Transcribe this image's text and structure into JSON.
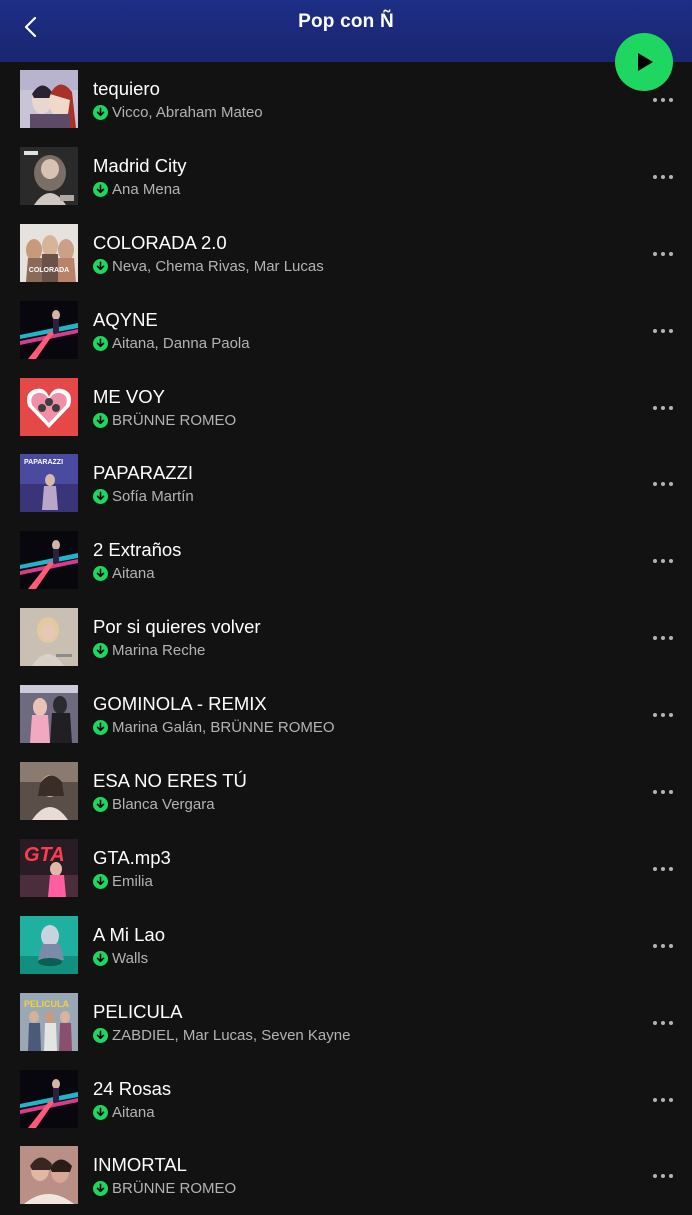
{
  "header": {
    "title": "Pop con Ñ",
    "background": "#1d2e86"
  },
  "play_button": {
    "color": "#1ed760",
    "icon": "play-icon"
  },
  "accent": "#1ed760",
  "tracks": [
    {
      "title": "tequiero",
      "artists": "Vicco, Abraham Mateo",
      "downloaded": true
    },
    {
      "title": "Madrid City",
      "artists": "Ana Mena",
      "downloaded": true
    },
    {
      "title": "COLORADA 2.0",
      "artists": "Neva, Chema Rivas, Mar Lucas",
      "downloaded": true
    },
    {
      "title": "AQYNE",
      "artists": "Aitana, Danna Paola",
      "downloaded": true
    },
    {
      "title": "ME VOY",
      "artists": "BRÜNNE ROMEO",
      "downloaded": true
    },
    {
      "title": "PAPARAZZI",
      "artists": "Sofía Martín",
      "downloaded": true
    },
    {
      "title": "2 Extraños",
      "artists": "Aitana",
      "downloaded": true
    },
    {
      "title": "Por si quieres volver",
      "artists": "Marina Reche",
      "downloaded": true
    },
    {
      "title": "GOMINOLA - REMIX",
      "artists": "Marina Galán, BRÜNNE ROMEO",
      "downloaded": true
    },
    {
      "title": "ESA NO ERES TÚ",
      "artists": "Blanca Vergara",
      "downloaded": true
    },
    {
      "title": "GTA.mp3",
      "artists": "Emilia",
      "downloaded": true
    },
    {
      "title": "A Mi Lao",
      "artists": "Walls",
      "downloaded": true
    },
    {
      "title": "PELICULA",
      "artists": "ZABDIEL, Mar Lucas, Seven Kayne",
      "downloaded": true
    },
    {
      "title": "24 Rosas",
      "artists": "Aitana",
      "downloaded": true
    },
    {
      "title": "INMORTAL",
      "artists": "BRÜNNE ROMEO",
      "downloaded": true
    }
  ],
  "cover_text": {
    "colorada": "COLORADA",
    "paparazzi": "PAPARAZZI",
    "gta": "GTA",
    "pelicula": "PELICULA"
  }
}
